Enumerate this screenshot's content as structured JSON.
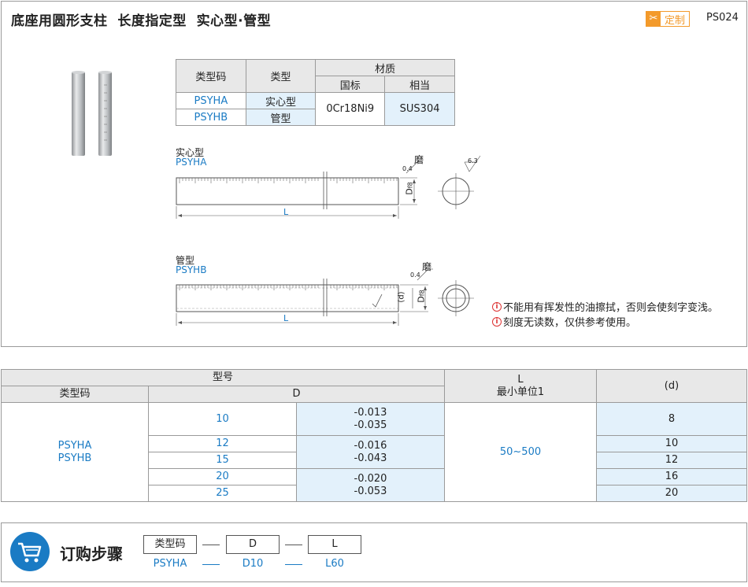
{
  "header": {
    "title": "底座用圆形支柱  长度指定型  实心型·管型",
    "badge_label": "定制",
    "badge_icon": "scissors-icon",
    "product_code": "PS024"
  },
  "material_table": {
    "col_type_code": "类型码",
    "col_type": "类型",
    "col_material": "材质",
    "col_gb": "国标",
    "col_equiv": "相当",
    "rows": [
      {
        "code": "PSYHA",
        "type": "实心型"
      },
      {
        "code": "PSYHB",
        "type": "管型"
      }
    ],
    "gb_value": "0Cr18Ni9",
    "equiv_value": "SUS304"
  },
  "drawings": {
    "solid": {
      "label": "实心型",
      "code": "PSYHA",
      "grind": "磨",
      "tol": "0.4",
      "roughness": "6.3",
      "dim_d": "D",
      "dim_d_sub": "f8",
      "dim_l": "L"
    },
    "tube": {
      "label": "管型",
      "code": "PSYHB",
      "grind": "磨",
      "tol": "0.4",
      "dim_d": "D",
      "dim_d_sub": "f8",
      "dim_inner": "(d)",
      "dim_l": "L"
    }
  },
  "notes": [
    "不能用有挥发性的油擦拭，否则会使刻字变浅。",
    "刻度无读数，仅供参考使用。"
  ],
  "spec_table": {
    "h_model": "型号",
    "h_type_code": "类型码",
    "h_d": "D",
    "h_l": "L",
    "h_l_sub": "最小单位1",
    "h_inner": "(d)",
    "codes": [
      "PSYHA",
      "PSYHB"
    ],
    "d_values": [
      "10",
      "12",
      "15",
      "20",
      "25"
    ],
    "tol_groups": [
      [
        "-0.013",
        "-0.035"
      ],
      [
        "-0.016",
        "-0.043"
      ],
      [
        "-0.020",
        "-0.053"
      ]
    ],
    "l_range": "50~500",
    "inner_values": [
      "8",
      "10",
      "12",
      "16",
      "20"
    ]
  },
  "order": {
    "title": "订购步骤",
    "cart_icon": "cart-icon",
    "headers": [
      "类型码",
      "D",
      "L"
    ],
    "example": [
      "PSYHA",
      "D10",
      "L60"
    ]
  }
}
